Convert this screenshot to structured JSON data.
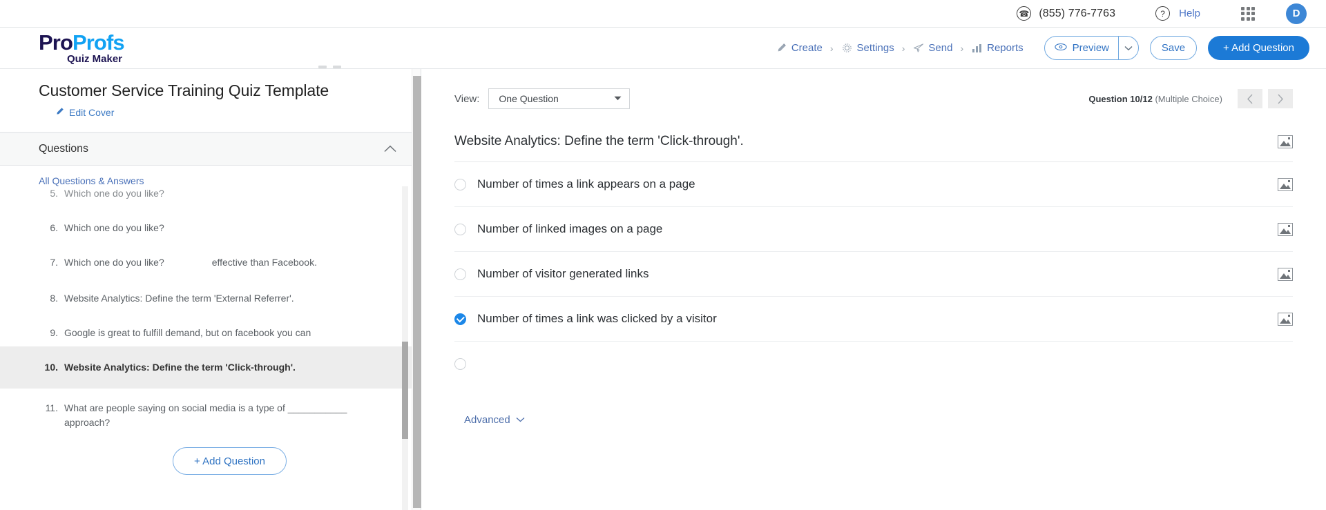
{
  "topbar": {
    "phone_icon": "phone-icon",
    "phone": "(855) 776-7763",
    "help_icon": "question-mark-icon",
    "help": "Help",
    "apps_icon": "apps-grid-icon",
    "avatar_initial": "D",
    "avatar_color": "#3d87d6"
  },
  "brand": {
    "name_part1": "Pro",
    "name_part2": "Profs",
    "subtitle": "Quiz Maker",
    "color_dark": "#1d1452",
    "color_light": "#11a2f3"
  },
  "nav": {
    "breadcrumbs": [
      {
        "label": "Create",
        "icon": "pencil-icon"
      },
      {
        "label": "Settings",
        "icon": "gear-icon"
      },
      {
        "label": "Send",
        "icon": "paper-plane-icon"
      },
      {
        "label": "Reports",
        "icon": "bar-chart-icon"
      }
    ],
    "separator": "›",
    "preview_label": "Preview",
    "preview_icon": "eye-icon",
    "preview_caret_icon": "chevron-down-icon",
    "save_label": "Save",
    "add_question_label": "+ Add Question",
    "accent": "#1c7ad6"
  },
  "sidebar": {
    "quiz_title": "Customer Service Training Quiz Template",
    "edit_cover_label": "Edit Cover",
    "edit_cover_icon": "pencil-icon",
    "questions_header": "Questions",
    "collapse_icon": "chevron-up-icon",
    "all_qa_label": "All Questions & Answers",
    "questions": [
      {
        "num": "5.",
        "text": "Which one do you like?",
        "active": false,
        "fragment": ""
      },
      {
        "num": "6.",
        "text": "Which one do you like?",
        "active": false,
        "fragment": ""
      },
      {
        "num": "7.",
        "text": "Which one do you like?",
        "active": false,
        "fragment": "effective than Facebook."
      },
      {
        "num": "8.",
        "text": "Website Analytics: Define the term 'External Referrer'.",
        "active": false,
        "fragment": ""
      },
      {
        "num": "9.",
        "text": "Google is great to fulfill demand, but on facebook you can",
        "active": false,
        "fragment": ""
      },
      {
        "num": "10.",
        "text": "Website Analytics: Define the term 'Click-through'.",
        "active": true,
        "fragment": ""
      },
      {
        "num": "11.",
        "text": "What are people saying on social media is a type of ___________ approach?",
        "active": false,
        "fragment": ""
      }
    ],
    "add_question_label": "+ Add Question"
  },
  "main": {
    "view_label": "View:",
    "view_value": "One Question",
    "view_caret_icon": "caret-down-icon",
    "question_counter": "Question 10/12",
    "question_type": "(Multiple Choice)",
    "prev_icon": "chevron-left-icon",
    "next_icon": "chevron-right-icon",
    "question_text": "Website Analytics: Define the term 'Click-through'.",
    "image_icon": "image-placeholder-icon",
    "options": [
      {
        "text": "Number of times a link appears on a page",
        "checked": false
      },
      {
        "text": "Number of linked images on a page",
        "checked": false
      },
      {
        "text": "Number of visitor generated links",
        "checked": false
      },
      {
        "text": "Number of times a link was clicked by a visitor",
        "checked": true
      },
      {
        "text": "",
        "checked": false
      }
    ],
    "advanced_label": "Advanced",
    "advanced_caret_icon": "chevron-down-icon"
  }
}
